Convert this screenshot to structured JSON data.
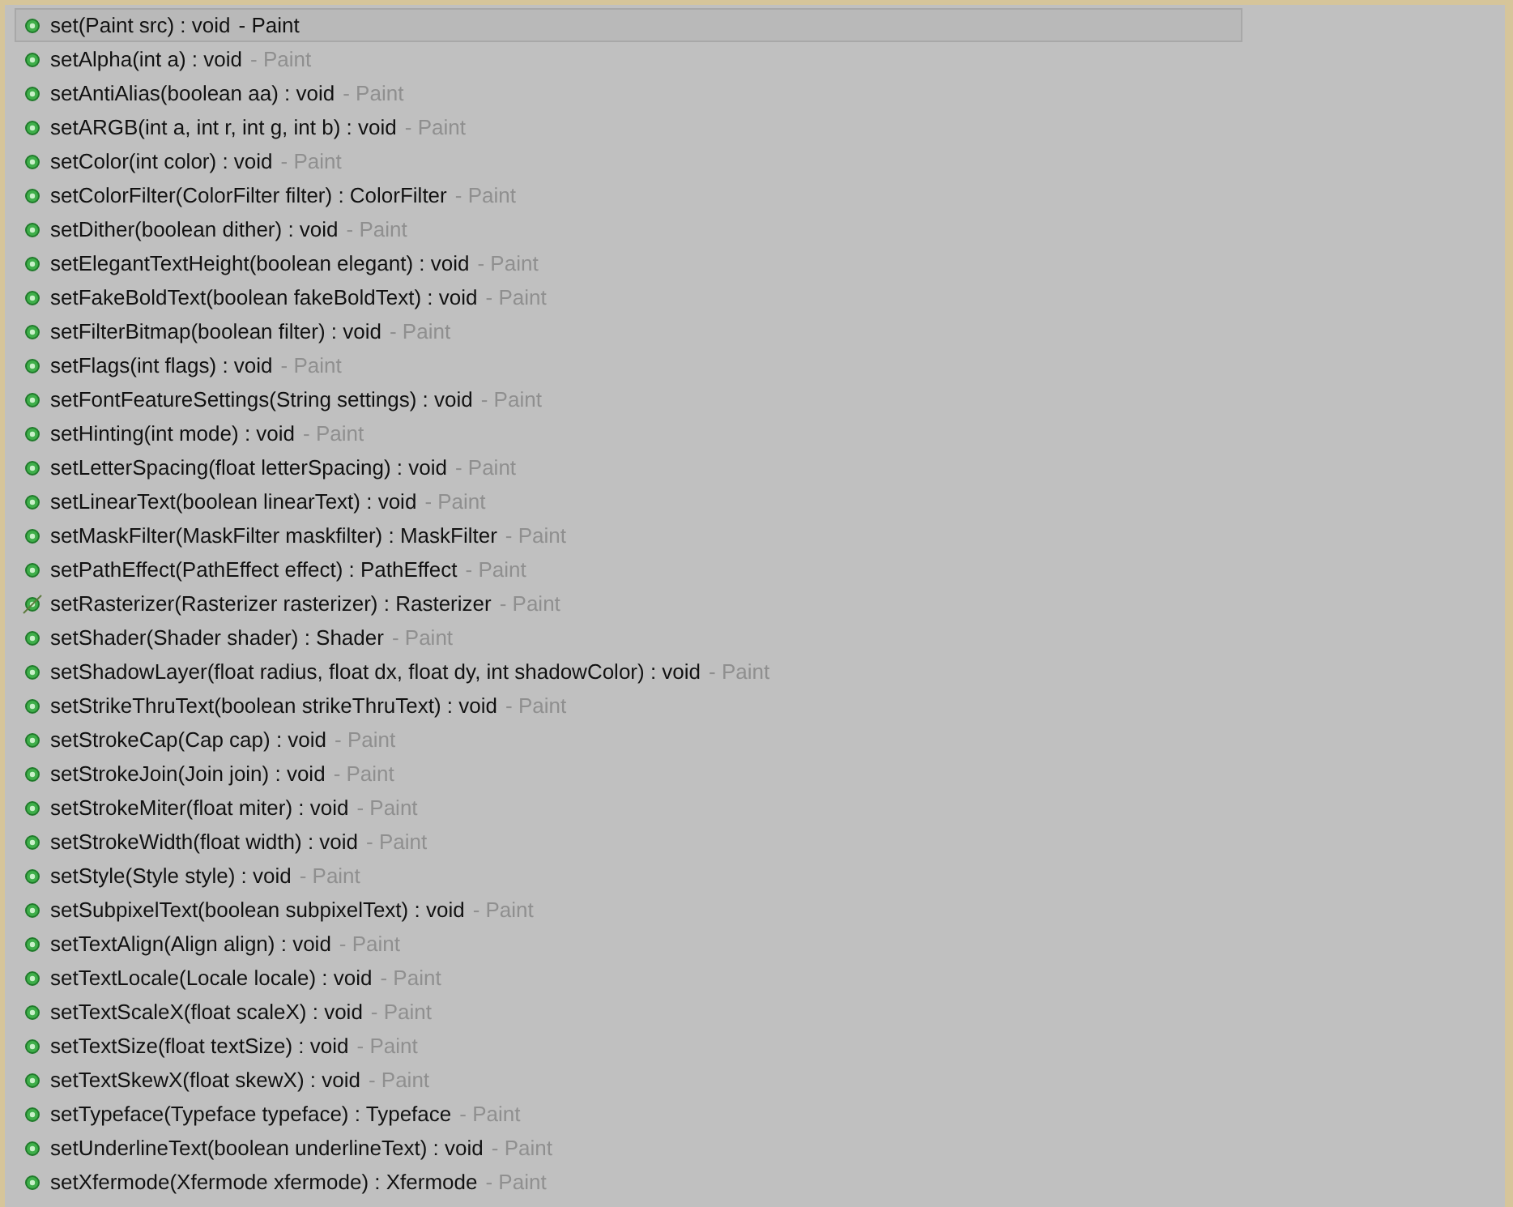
{
  "items": [
    {
      "signature": "set(Paint src) : void",
      "owner": "- Paint",
      "selected": true,
      "deprecated": false
    },
    {
      "signature": "setAlpha(int a) : void",
      "owner": "- Paint",
      "selected": false,
      "deprecated": false
    },
    {
      "signature": "setAntiAlias(boolean aa) : void",
      "owner": "- Paint",
      "selected": false,
      "deprecated": false
    },
    {
      "signature": "setARGB(int a, int r, int g, int b) : void",
      "owner": "- Paint",
      "selected": false,
      "deprecated": false
    },
    {
      "signature": "setColor(int color) : void",
      "owner": "- Paint",
      "selected": false,
      "deprecated": false
    },
    {
      "signature": "setColorFilter(ColorFilter filter) : ColorFilter",
      "owner": "- Paint",
      "selected": false,
      "deprecated": false
    },
    {
      "signature": "setDither(boolean dither) : void",
      "owner": "- Paint",
      "selected": false,
      "deprecated": false
    },
    {
      "signature": "setElegantTextHeight(boolean elegant) : void",
      "owner": "- Paint",
      "selected": false,
      "deprecated": false
    },
    {
      "signature": "setFakeBoldText(boolean fakeBoldText) : void",
      "owner": "- Paint",
      "selected": false,
      "deprecated": false
    },
    {
      "signature": "setFilterBitmap(boolean filter) : void",
      "owner": "- Paint",
      "selected": false,
      "deprecated": false
    },
    {
      "signature": "setFlags(int flags) : void",
      "owner": "- Paint",
      "selected": false,
      "deprecated": false
    },
    {
      "signature": "setFontFeatureSettings(String settings) : void",
      "owner": "- Paint",
      "selected": false,
      "deprecated": false
    },
    {
      "signature": "setHinting(int mode) : void",
      "owner": "- Paint",
      "selected": false,
      "deprecated": false
    },
    {
      "signature": "setLetterSpacing(float letterSpacing) : void",
      "owner": "- Paint",
      "selected": false,
      "deprecated": false
    },
    {
      "signature": "setLinearText(boolean linearText) : void",
      "owner": "- Paint",
      "selected": false,
      "deprecated": false
    },
    {
      "signature": "setMaskFilter(MaskFilter maskfilter) : MaskFilter",
      "owner": "- Paint",
      "selected": false,
      "deprecated": false
    },
    {
      "signature": "setPathEffect(PathEffect effect) : PathEffect",
      "owner": "- Paint",
      "selected": false,
      "deprecated": false
    },
    {
      "signature": "setRasterizer(Rasterizer rasterizer) : Rasterizer",
      "owner": "- Paint",
      "selected": false,
      "deprecated": true
    },
    {
      "signature": "setShader(Shader shader) : Shader",
      "owner": "- Paint",
      "selected": false,
      "deprecated": false
    },
    {
      "signature": "setShadowLayer(float radius, float dx, float dy, int shadowColor) : void",
      "owner": "- Paint",
      "selected": false,
      "deprecated": false
    },
    {
      "signature": "setStrikeThruText(boolean strikeThruText) : void",
      "owner": "- Paint",
      "selected": false,
      "deprecated": false
    },
    {
      "signature": "setStrokeCap(Cap cap) : void",
      "owner": "- Paint",
      "selected": false,
      "deprecated": false
    },
    {
      "signature": "setStrokeJoin(Join join) : void",
      "owner": "- Paint",
      "selected": false,
      "deprecated": false
    },
    {
      "signature": "setStrokeMiter(float miter) : void",
      "owner": "- Paint",
      "selected": false,
      "deprecated": false
    },
    {
      "signature": "setStrokeWidth(float width) : void",
      "owner": "- Paint",
      "selected": false,
      "deprecated": false
    },
    {
      "signature": "setStyle(Style style) : void",
      "owner": "- Paint",
      "selected": false,
      "deprecated": false
    },
    {
      "signature": "setSubpixelText(boolean subpixelText) : void",
      "owner": "- Paint",
      "selected": false,
      "deprecated": false
    },
    {
      "signature": "setTextAlign(Align align) : void",
      "owner": "- Paint",
      "selected": false,
      "deprecated": false
    },
    {
      "signature": "setTextLocale(Locale locale) : void",
      "owner": "- Paint",
      "selected": false,
      "deprecated": false
    },
    {
      "signature": "setTextScaleX(float scaleX) : void",
      "owner": "- Paint",
      "selected": false,
      "deprecated": false
    },
    {
      "signature": "setTextSize(float textSize) : void",
      "owner": "- Paint",
      "selected": false,
      "deprecated": false
    },
    {
      "signature": "setTextSkewX(float skewX) : void",
      "owner": "- Paint",
      "selected": false,
      "deprecated": false
    },
    {
      "signature": "setTypeface(Typeface typeface) : Typeface",
      "owner": "- Paint",
      "selected": false,
      "deprecated": false
    },
    {
      "signature": "setUnderlineText(boolean underlineText) : void",
      "owner": "- Paint",
      "selected": false,
      "deprecated": false
    },
    {
      "signature": "setXfermode(Xfermode xfermode) : Xfermode",
      "owner": "- Paint",
      "selected": false,
      "deprecated": false
    }
  ]
}
